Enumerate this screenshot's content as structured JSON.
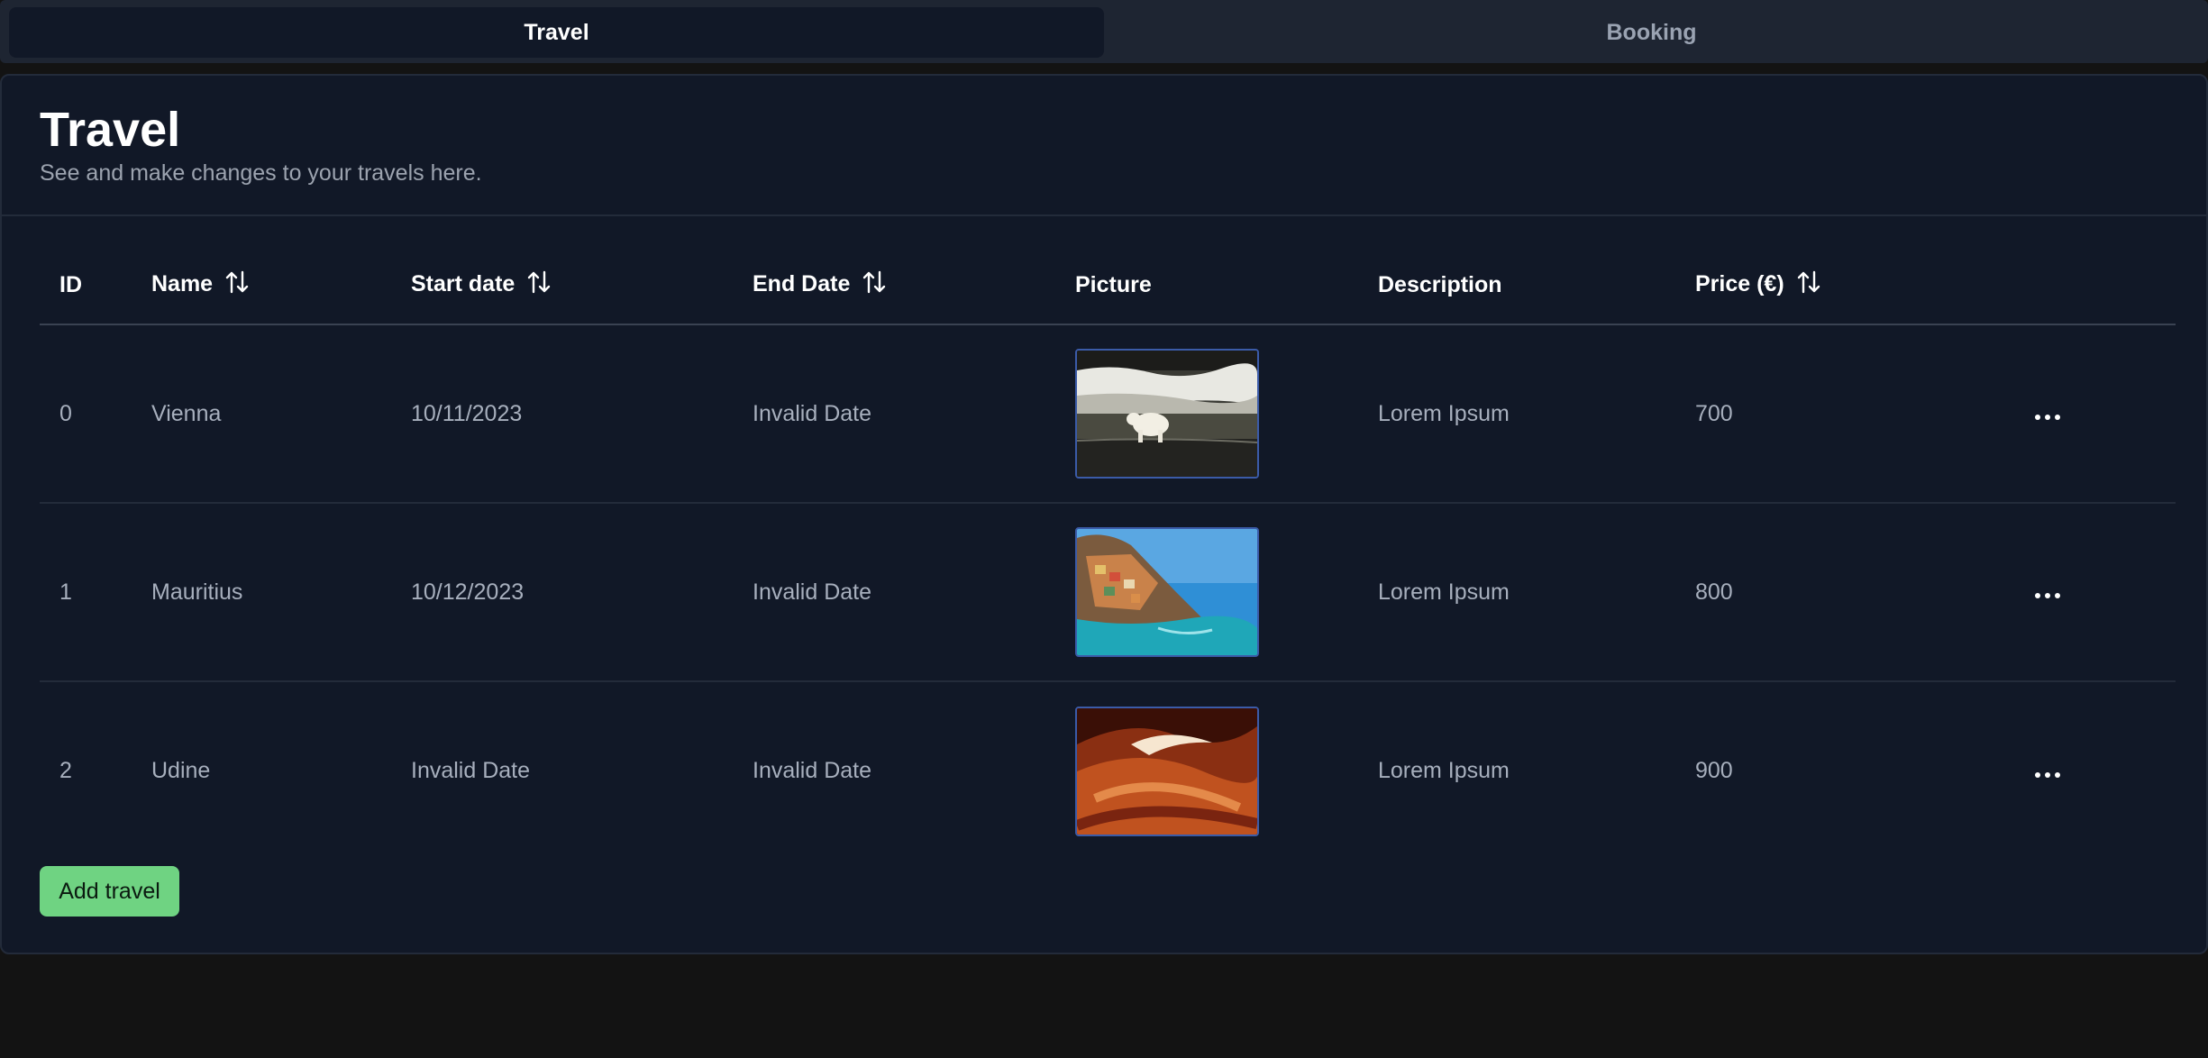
{
  "tabs": [
    {
      "label": "Travel",
      "active": true
    },
    {
      "label": "Booking",
      "active": false
    }
  ],
  "card": {
    "title": "Travel",
    "subtitle": "See and make changes to your travels here."
  },
  "table": {
    "columns": [
      "ID",
      "Name",
      "Start date",
      "End Date",
      "Picture",
      "Description",
      "Price (€)"
    ],
    "sortable": [
      "Name",
      "Start date",
      "End Date",
      "Price (€)"
    ],
    "rows": [
      {
        "id": "0",
        "name": "Vienna",
        "start": "10/11/2023",
        "end": "Invalid Date",
        "picture": "polar-bear-photo",
        "description": "Lorem Ipsum",
        "price": "700"
      },
      {
        "id": "1",
        "name": "Mauritius",
        "start": "10/12/2023",
        "end": "Invalid Date",
        "picture": "coastal-village-photo",
        "description": "Lorem Ipsum",
        "price": "800"
      },
      {
        "id": "2",
        "name": "Udine",
        "start": "Invalid Date",
        "end": "Invalid Date",
        "picture": "red-canyon-photo",
        "description": "Lorem Ipsum",
        "price": "900"
      }
    ],
    "row_action_icon": "more-horizontal-icon"
  },
  "add_button": {
    "label": "Add travel"
  },
  "colors": {
    "background": "#131313",
    "card": "#111827",
    "tab_bar": "#1e2532",
    "accent_button": "#6fd382",
    "thumb_border": "#3b5ba8"
  }
}
